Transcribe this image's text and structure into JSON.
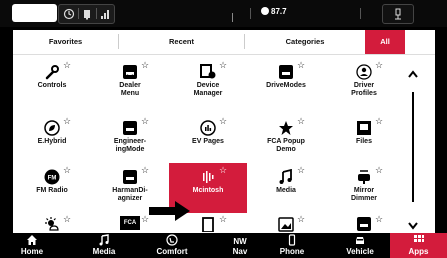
{
  "status": {
    "temperature": "87.7"
  },
  "tabs": [
    {
      "label": "Favorites"
    },
    {
      "label": "Recent"
    },
    {
      "label": "Categories"
    },
    {
      "label": "All"
    }
  ],
  "apps": [
    {
      "label": "Controls",
      "icon": "wrench-icon"
    },
    {
      "label": "Dealer\nMenu",
      "icon": "car-screen-icon"
    },
    {
      "label": "Device\nManager",
      "icon": "device-manager-icon"
    },
    {
      "label": "DriveModes",
      "icon": "car-screen-icon"
    },
    {
      "label": "Driver\nProfiles",
      "icon": "driver-profile-icon"
    },
    {
      "label": "E.Hybrid",
      "icon": "leaf-icon"
    },
    {
      "label": "Engineer-\ningMode",
      "icon": "car-screen-icon"
    },
    {
      "label": "EV Pages",
      "icon": "ev-gauge-icon"
    },
    {
      "label": "FCA Popup\nDemo",
      "icon": "star-icon"
    },
    {
      "label": "Files",
      "icon": "file-icon"
    },
    {
      "label": "FM Radio",
      "icon": "fm-radio-icon"
    },
    {
      "label": "HarmanDi-\nagnizer",
      "icon": "car-screen-icon"
    },
    {
      "label": "Mcintosh",
      "icon": "mcintosh-icon"
    },
    {
      "label": "Media",
      "icon": "music-note-icon"
    },
    {
      "label": "Mirror\nDimmer",
      "icon": "mirror-icon"
    }
  ],
  "nav": [
    {
      "label": "Home",
      "icon": "home-icon"
    },
    {
      "label": "Media",
      "icon": "music-note-icon"
    },
    {
      "label": "Comfort",
      "icon": "seat-icon"
    },
    {
      "label": "Nav",
      "icon": "compass-icon",
      "heading": "NW"
    },
    {
      "label": "Phone",
      "icon": "phone-icon"
    },
    {
      "label": "Vehicle",
      "icon": "car-icon"
    },
    {
      "label": "Apps",
      "icon": "apps-grid-icon"
    }
  ],
  "partial_row_badges": {
    "fca": "FCA"
  },
  "colors": {
    "accent": "#d31c3c",
    "panel": "#ffffff",
    "bar": "#000000"
  }
}
